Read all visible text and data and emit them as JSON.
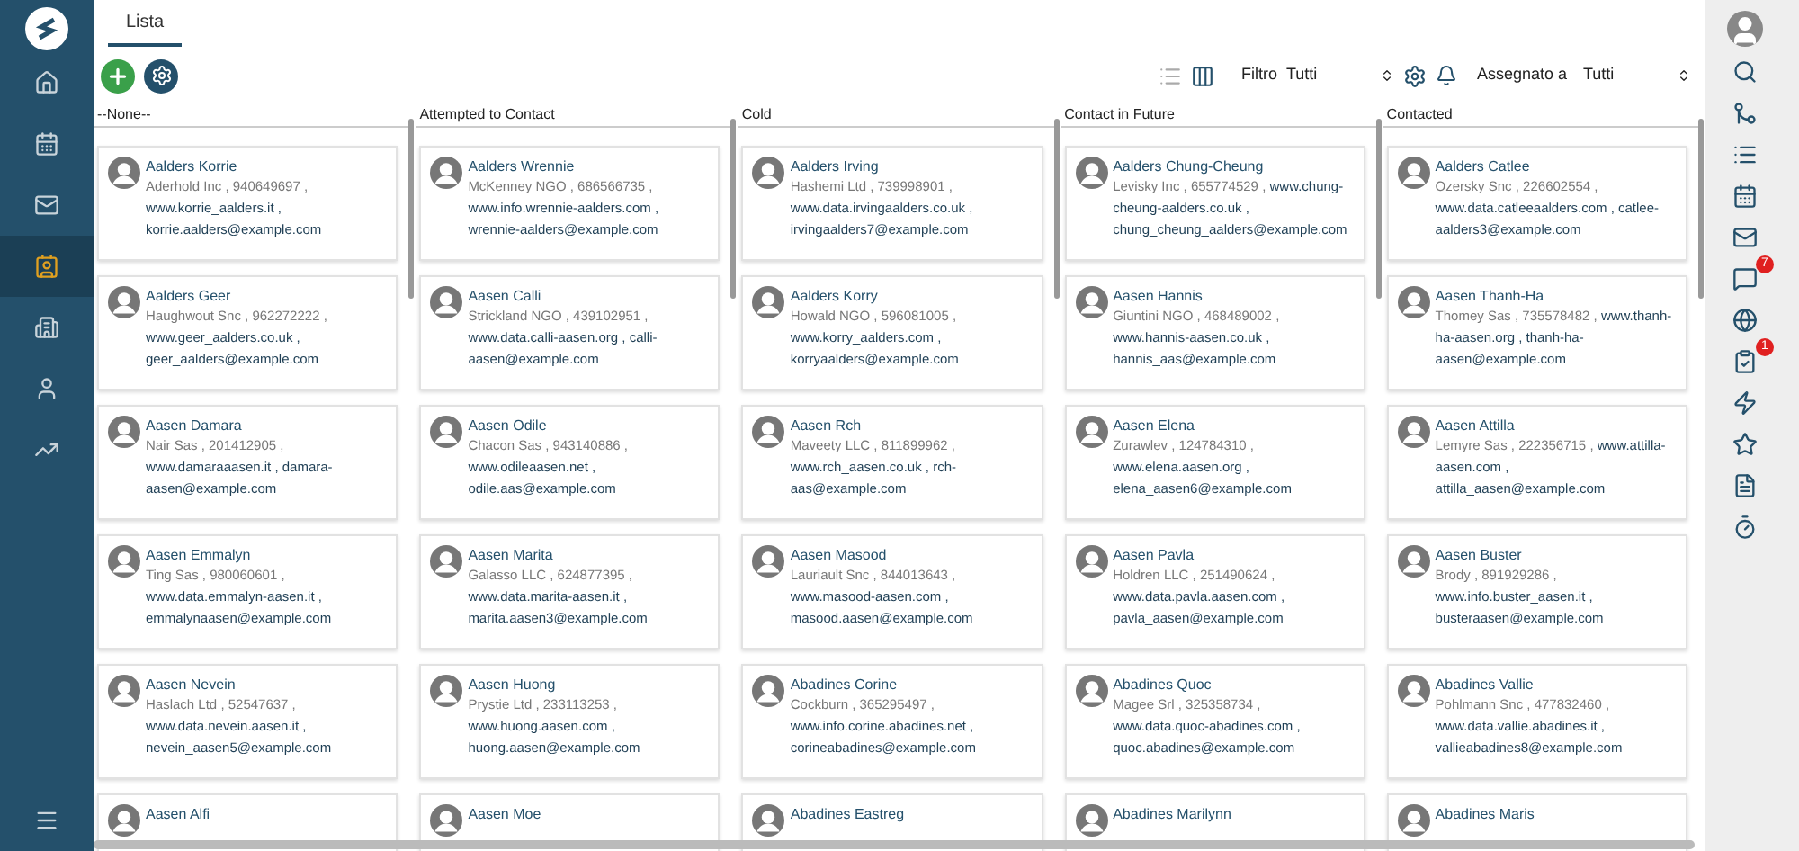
{
  "nav": [
    {
      "kind": "home",
      "selected": false
    },
    {
      "kind": "calendar",
      "selected": false
    },
    {
      "kind": "mail",
      "selected": false
    },
    {
      "kind": "contact",
      "selected": true
    },
    {
      "kind": "building",
      "selected": false
    },
    {
      "kind": "person",
      "selected": false
    },
    {
      "kind": "chart",
      "selected": false
    }
  ],
  "tabs": [
    {
      "label": "Lista",
      "selected": true
    }
  ],
  "toolbar": {
    "views": [
      {
        "kind": "list",
        "selected": false
      },
      {
        "kind": "columns",
        "selected": true
      }
    ],
    "filter_label": "Filtro",
    "filter_value": "Tutti",
    "assigned_label": "Assegnato a",
    "assigned_value": "Tutti"
  },
  "columns": [
    {
      "title": "--None--",
      "cards": [
        {
          "name": "Aalders Korrie",
          "company": "Aderhold Inc , 940649697 ,",
          "contact": "www.korrie_aalders.it , korrie.aalders@example.com"
        },
        {
          "name": "Aalders Geer",
          "company": "Haughwout Snc , 962272222 ,",
          "contact": "www.geer_aalders.co.uk , geer_aalders@example.com"
        },
        {
          "name": "Aasen Damara",
          "company": "Nair Sas , 201412905 ,",
          "contact": "www.damaraaasen.it , damara-aasen@example.com"
        },
        {
          "name": "Aasen Emmalyn",
          "company": "Ting Sas , 980060601 ,",
          "contact": "www.data.emmalyn-aasen.it , emmalynaasen@example.com"
        },
        {
          "name": "Aasen Nevein",
          "company": "Haslach Ltd , 52547637 ,",
          "contact": "www.data.nevein.aasen.it , nevein_aasen5@example.com"
        },
        {
          "name": "Aasen Alfi"
        }
      ]
    },
    {
      "title": "Attempted to Contact",
      "cards": [
        {
          "name": "Aalders Wrennie",
          "company": "McKenney NGO , 686566735 ,",
          "contact": "www.info.wrennie-aalders.com , wrennie-aalders@example.com"
        },
        {
          "name": "Aasen Calli",
          "company": "Strickland NGO , 439102951 ,",
          "contact": "www.data.calli-aasen.org , calli-aasen@example.com"
        },
        {
          "name": "Aasen Odile",
          "company": "Chacon Sas , 943140886 ,",
          "contact": "www.odileaasen.net , odile.aas@example.com"
        },
        {
          "name": "Aasen Marita",
          "company": "Galasso LLC , 624877395 ,",
          "contact": "www.data.marita-aasen.it , marita.aasen3@example.com"
        },
        {
          "name": "Aasen Huong",
          "company": "Prystie Ltd , 233113253 ,",
          "contact": "www.huong.aasen.com , huong.aasen@example.com"
        },
        {
          "name": "Aasen Moe"
        }
      ]
    },
    {
      "title": "Cold",
      "cards": [
        {
          "name": "Aalders Irving",
          "company": "Hashemi Ltd , 739998901 ,",
          "contact": "www.data.irvingaalders.co.uk , irvingaalders7@example.com"
        },
        {
          "name": "Aalders Korry",
          "company": "Howald NGO , 596081005 ,",
          "contact": "www.korry_aalders.com , korryaalders@example.com"
        },
        {
          "name": "Aasen Rch",
          "company": "Maveety LLC , 811899962 ,",
          "contact": "www.rch_aasen.co.uk , rch-aas@example.com"
        },
        {
          "name": "Aasen Masood",
          "company": "Lauriault Snc , 844013643 ,",
          "contact": "www.masood-aasen.com , masood.aasen@example.com"
        },
        {
          "name": "Abadines Corine",
          "company": "Cockburn , 365295497 ,",
          "contact": "www.info.corine.abadines.net , corineabadines@example.com"
        },
        {
          "name": "Abadines Eastreg"
        }
      ]
    },
    {
      "title": "Contact in Future",
      "cards": [
        {
          "name": "Aalders Chung-Cheung",
          "company": "Levisky Inc , 655774529 ,",
          "contact": "www.chung-cheung-aalders.co.uk , chung_cheung_aalders@example.com"
        },
        {
          "name": "Aasen Hannis",
          "company": "Giuntini NGO , 468489002 ,",
          "contact": "www.hannis-aasen.co.uk , hannis_aas@example.com"
        },
        {
          "name": "Aasen Elena",
          "company": "Zurawlev , 124784310 ,",
          "contact": "www.elena.aasen.org , elena_aasen6@example.com"
        },
        {
          "name": "Aasen Pavla",
          "company": "Holdren LLC , 251490624 ,",
          "contact": "www.data.pavla.aasen.com , pavla_aasen@example.com"
        },
        {
          "name": "Abadines Quoc",
          "company": "Magee Srl , 325358734 ,",
          "contact": "www.data.quoc-abadines.com , quoc.abadines@example.com"
        },
        {
          "name": "Abadines Marilynn"
        }
      ]
    },
    {
      "title": "Contacted",
      "cards": [
        {
          "name": "Aalders Catlee",
          "company": "Ozersky Snc , 226602554 ,",
          "contact": "www.data.catleeaalders.com , catlee-aalders3@example.com"
        },
        {
          "name": "Aasen Thanh-Ha",
          "company": "Thomey Sas , 735578482 ,",
          "contact": "www.thanh-ha-aasen.org , thanh-ha-aasen@example.com"
        },
        {
          "name": "Aasen Attilla",
          "company": "Lemyre Sas , 222356715 ,",
          "contact": "www.attilla-aasen.com , attilla_aasen@example.com"
        },
        {
          "name": "Aasen Buster",
          "company": "Brody , 891929286 ,",
          "contact": "www.info.buster_aasen.it , busteraasen@example.com"
        },
        {
          "name": "Abadines Vallie",
          "company": "Pohlmann Snc , 477832460 ,",
          "contact": "www.data.vallie.abadines.it , vallieabadines8@example.com"
        },
        {
          "name": "Abadines Maris"
        }
      ]
    }
  ],
  "right_bar": [
    {
      "kind": "search"
    },
    {
      "kind": "merge"
    },
    {
      "kind": "list"
    },
    {
      "kind": "calendar"
    },
    {
      "kind": "mail"
    },
    {
      "kind": "chat",
      "badge": "7"
    },
    {
      "kind": "globe"
    },
    {
      "kind": "task",
      "badge": "1"
    },
    {
      "kind": "bolt"
    },
    {
      "kind": "star"
    },
    {
      "kind": "document"
    },
    {
      "kind": "timer"
    }
  ]
}
